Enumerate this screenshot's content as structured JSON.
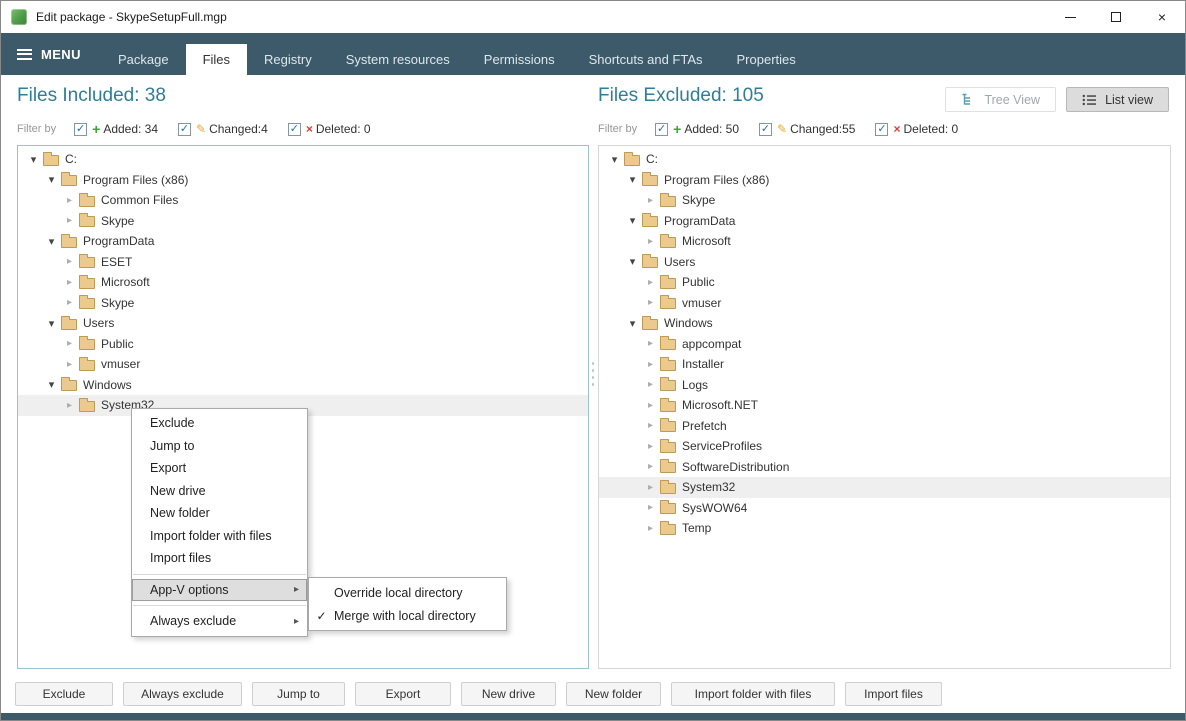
{
  "window": {
    "title": "Edit package - SkypeSetupFull.mgp"
  },
  "icons": {
    "menu": "hamburger",
    "check": "✓",
    "collapsed": "▸",
    "expanded": "▾",
    "submenu_arrow": "▸",
    "close": "×",
    "added": "+",
    "changed": "✎",
    "deleted": "×"
  },
  "menu_bar": {
    "menu_label": "MENU",
    "tabs": [
      {
        "label": "Package",
        "active": false
      },
      {
        "label": "Files",
        "active": true
      },
      {
        "label": "Registry",
        "active": false
      },
      {
        "label": "System resources",
        "active": false
      },
      {
        "label": "Permissions",
        "active": false
      },
      {
        "label": "Shortcuts and FTAs",
        "active": false
      },
      {
        "label": "Properties",
        "active": false
      }
    ]
  },
  "left_panel": {
    "title": "Files Included: 38",
    "filter_label": "Filter by",
    "filters": [
      {
        "label": "Added: 34",
        "type": "added",
        "checked": true
      },
      {
        "label": "Changed:4",
        "type": "changed",
        "checked": true
      },
      {
        "label": "Deleted: 0",
        "type": "deleted",
        "checked": true
      }
    ],
    "tree": [
      {
        "label": "C:",
        "level": 0,
        "state": "expanded",
        "selected": false
      },
      {
        "label": "Program Files (x86)",
        "level": 1,
        "state": "expanded",
        "selected": false
      },
      {
        "label": "Common Files",
        "level": 2,
        "state": "collapsed",
        "selected": false
      },
      {
        "label": "Skype",
        "level": 2,
        "state": "collapsed",
        "selected": false
      },
      {
        "label": "ProgramData",
        "level": 1,
        "state": "expanded",
        "selected": false
      },
      {
        "label": "ESET",
        "level": 2,
        "state": "collapsed",
        "selected": false
      },
      {
        "label": "Microsoft",
        "level": 2,
        "state": "collapsed",
        "selected": false
      },
      {
        "label": "Skype",
        "level": 2,
        "state": "collapsed",
        "selected": false
      },
      {
        "label": "Users",
        "level": 1,
        "state": "expanded",
        "selected": false
      },
      {
        "label": "Public",
        "level": 2,
        "state": "collapsed",
        "selected": false
      },
      {
        "label": "vmuser",
        "level": 2,
        "state": "collapsed",
        "selected": false
      },
      {
        "label": "Windows",
        "level": 1,
        "state": "expanded",
        "selected": false
      },
      {
        "label": "System32",
        "level": 2,
        "state": "collapsed",
        "selected": true
      }
    ]
  },
  "right_panel": {
    "title": "Files Excluded: 105",
    "filter_label": "Filter by",
    "view_buttons": [
      {
        "label": "Tree View",
        "active": false
      },
      {
        "label": "List view",
        "active": true
      }
    ],
    "filters": [
      {
        "label": "Added: 50",
        "type": "added",
        "checked": true
      },
      {
        "label": "Changed:55",
        "type": "changed",
        "checked": true
      },
      {
        "label": "Deleted: 0",
        "type": "deleted",
        "checked": true
      }
    ],
    "tree": [
      {
        "label": "C:",
        "level": 0,
        "state": "expanded",
        "selected": false
      },
      {
        "label": "Program Files (x86)",
        "level": 1,
        "state": "expanded",
        "selected": false
      },
      {
        "label": "Skype",
        "level": 2,
        "state": "collapsed",
        "selected": false
      },
      {
        "label": "ProgramData",
        "level": 1,
        "state": "expanded",
        "selected": false
      },
      {
        "label": "Microsoft",
        "level": 2,
        "state": "collapsed",
        "selected": false
      },
      {
        "label": "Users",
        "level": 1,
        "state": "expanded",
        "selected": false
      },
      {
        "label": "Public",
        "level": 2,
        "state": "collapsed",
        "selected": false
      },
      {
        "label": "vmuser",
        "level": 2,
        "state": "collapsed",
        "selected": false
      },
      {
        "label": "Windows",
        "level": 1,
        "state": "expanded",
        "selected": false
      },
      {
        "label": "appcompat",
        "level": 2,
        "state": "collapsed",
        "selected": false
      },
      {
        "label": "Installer",
        "level": 2,
        "state": "collapsed",
        "selected": false
      },
      {
        "label": "Logs",
        "level": 2,
        "state": "collapsed",
        "selected": false
      },
      {
        "label": "Microsoft.NET",
        "level": 2,
        "state": "collapsed",
        "selected": false
      },
      {
        "label": "Prefetch",
        "level": 2,
        "state": "collapsed",
        "selected": false
      },
      {
        "label": "ServiceProfiles",
        "level": 2,
        "state": "collapsed",
        "selected": false
      },
      {
        "label": "SoftwareDistribution",
        "level": 2,
        "state": "collapsed",
        "selected": false
      },
      {
        "label": "System32",
        "level": 2,
        "state": "collapsed",
        "selected": true
      },
      {
        "label": "SysWOW64",
        "level": 2,
        "state": "collapsed",
        "selected": false
      },
      {
        "label": "Temp",
        "level": 2,
        "state": "collapsed",
        "selected": false
      }
    ]
  },
  "context_menu": {
    "items": [
      {
        "label": "Exclude"
      },
      {
        "label": "Jump to"
      },
      {
        "label": "Export"
      },
      {
        "label": "New drive"
      },
      {
        "label": "New folder"
      },
      {
        "label": "Import folder with files"
      },
      {
        "label": "Import files"
      },
      {
        "separator": true
      },
      {
        "label": "App-V options",
        "submenu": true,
        "highlighted": true
      },
      {
        "separator": true
      },
      {
        "label": "Always exclude",
        "submenu": true
      }
    ],
    "submenu": [
      {
        "label": "Override local directory",
        "checked": false
      },
      {
        "label": "Merge with local directory",
        "checked": true
      }
    ]
  },
  "bottom_buttons": [
    "Exclude",
    "Always exclude",
    "Jump to",
    "Export",
    "New drive",
    "New folder",
    "Import folder with files",
    "Import files"
  ],
  "colors": {
    "menu_bar": "#3d5a6b",
    "header": "#2e7e99",
    "added": "#3aa63c",
    "changed": "#eda52f",
    "deleted": "#dd3c3c",
    "folder_fill": "#ecc98c",
    "folder_border": "#bf9a55",
    "selection": "#efefef",
    "check_blue": "#2d6ca2",
    "left_panel_border": "#9cc1d2",
    "right_panel_border": "#d6d6d6"
  }
}
